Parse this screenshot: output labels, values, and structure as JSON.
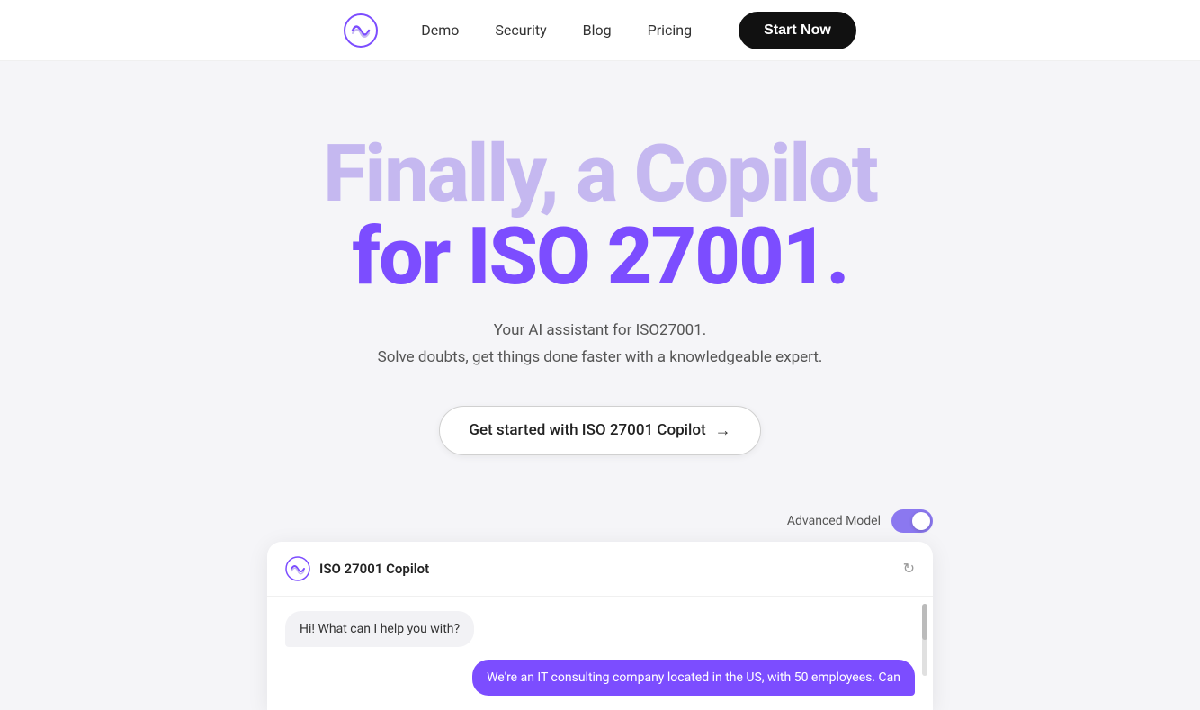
{
  "navbar": {
    "logo_alt": "Copilot Logo",
    "links": [
      {
        "label": "Demo",
        "name": "nav-demo"
      },
      {
        "label": "Security",
        "name": "nav-security"
      },
      {
        "label": "Blog",
        "name": "nav-blog"
      },
      {
        "label": "Pricing",
        "name": "nav-pricing"
      }
    ],
    "cta_label": "Start Now"
  },
  "hero": {
    "title_line1": "Finally, a Copilot",
    "title_line2": "for ISO 27001.",
    "subtitle1": "Your AI assistant for ISO27001.",
    "subtitle2": "Solve doubts, get things done faster with a knowledgeable expert.",
    "cta_label": "Get started with ISO 27001 Copilot",
    "arrow": "→"
  },
  "chat": {
    "advanced_model_label": "Advanced Model",
    "toggle_on": true,
    "header_title": "ISO 27001 Copilot",
    "refresh_icon": "↻",
    "bot_message": "Hi! What can I help you with?",
    "user_message": "We're an IT consulting company located in the US, with 50 employees. Can"
  }
}
